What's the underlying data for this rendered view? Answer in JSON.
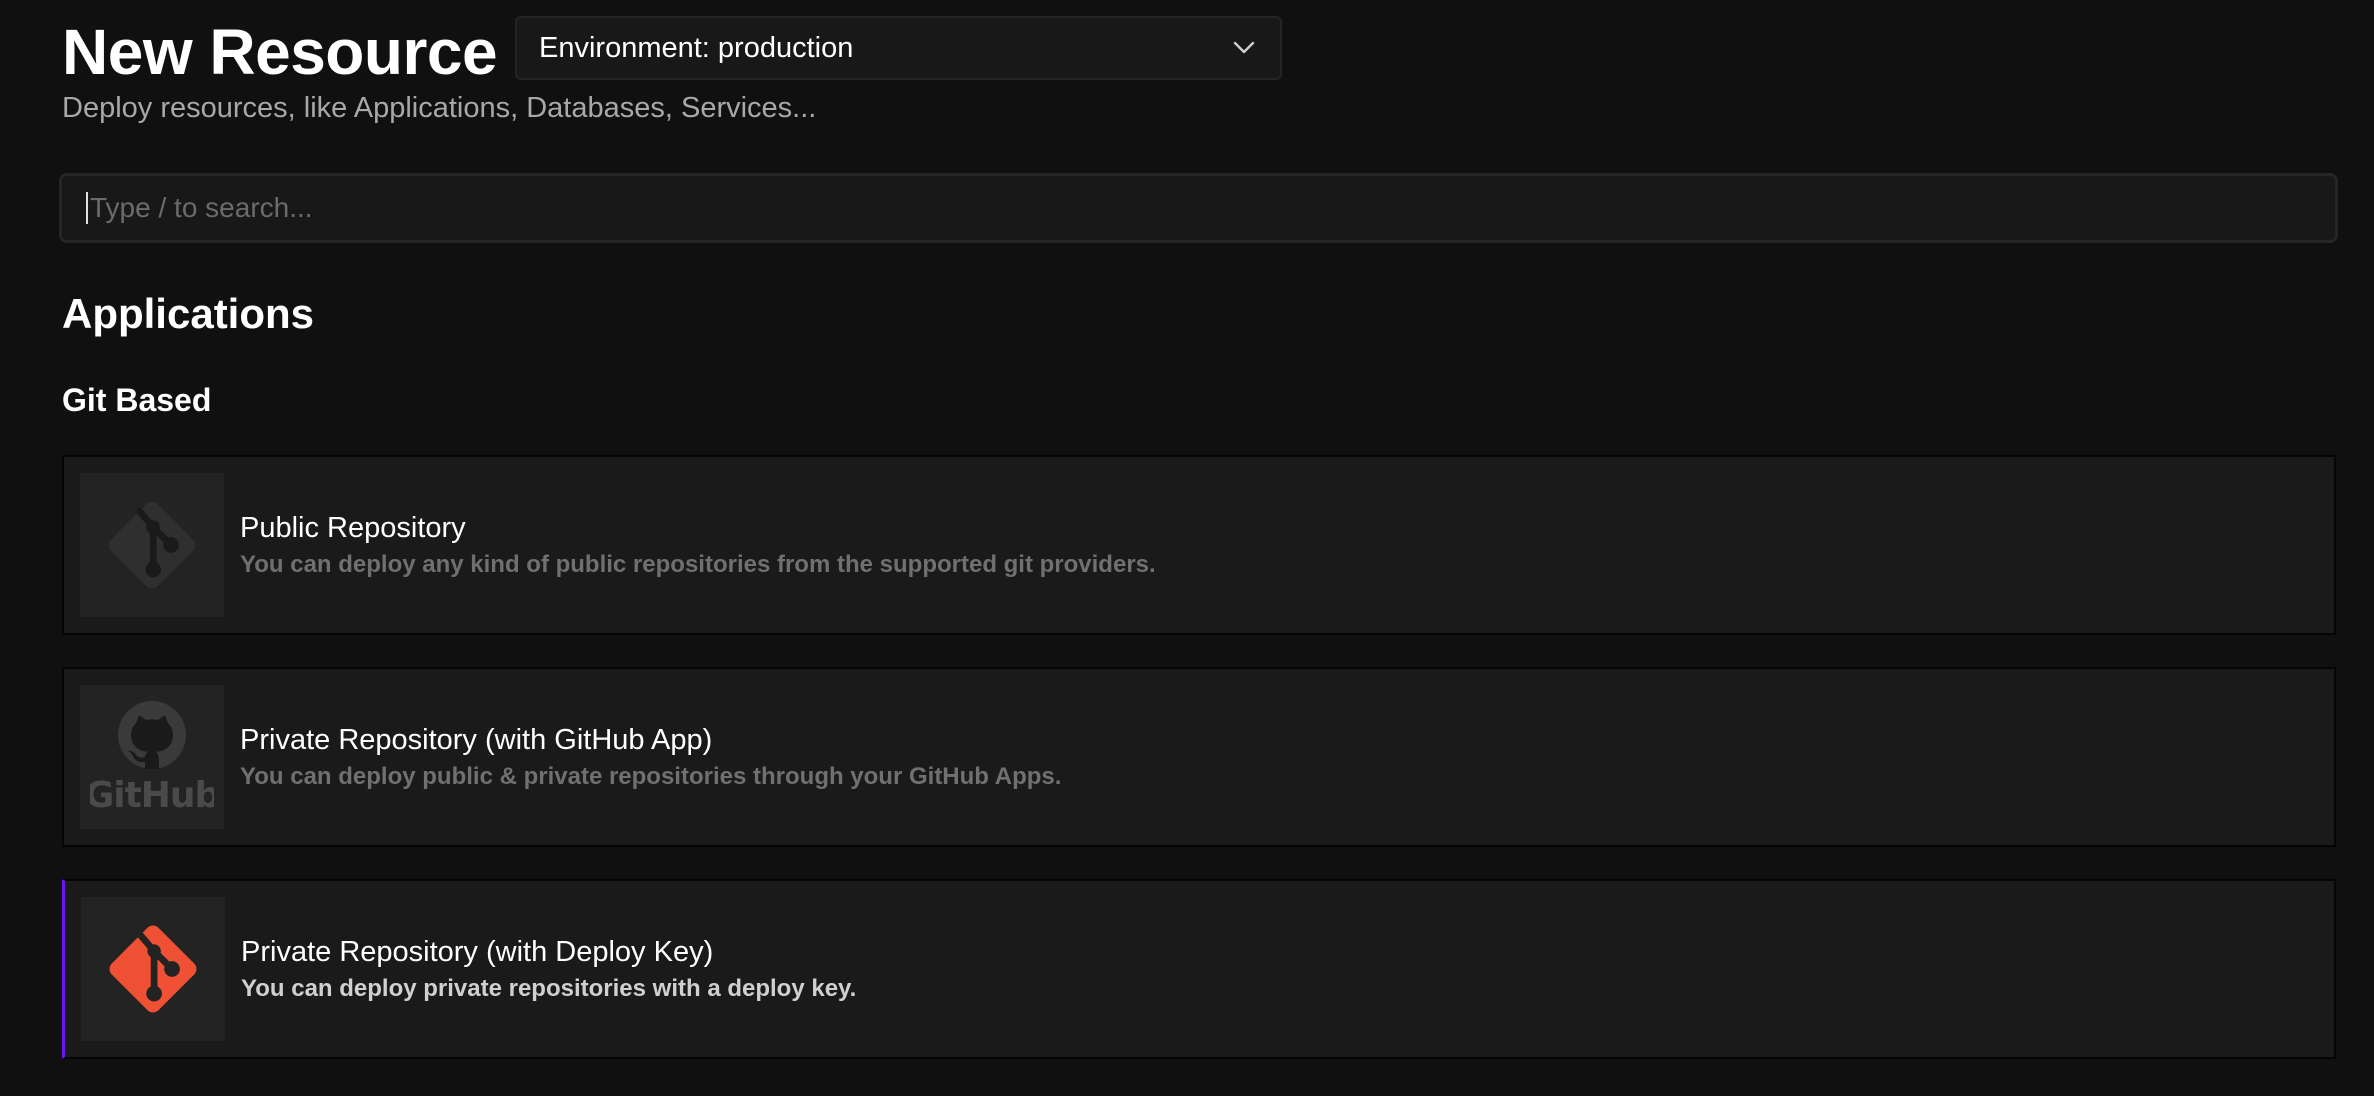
{
  "header": {
    "title": "New Resource",
    "subtitle": "Deploy resources, like Applications, Databases, Services..."
  },
  "environment_select": {
    "value": "Environment: production",
    "icon": "chevron-down-icon"
  },
  "search": {
    "placeholder": "Type / to search...",
    "value": ""
  },
  "sections": {
    "applications": {
      "title": "Applications",
      "git_based": {
        "title": "Git Based",
        "items": [
          {
            "name": "Public Repository",
            "description": "You can deploy any kind of public repositories from the supported git providers.",
            "icon": "git-icon",
            "state": "disabled"
          },
          {
            "name": "Private Repository (with GitHub App)",
            "description": "You can deploy public & private repositories through your GitHub Apps.",
            "icon": "github-icon",
            "logo_text": "GitHub",
            "state": "disabled"
          },
          {
            "name": "Private Repository (with Deploy Key)",
            "description": "You can deploy private repositories with a deploy key.",
            "icon": "git-icon",
            "state": "active"
          }
        ]
      }
    }
  },
  "colors": {
    "background": "#101010",
    "card": "#1a1a1a",
    "git_brand": "#f05033",
    "accent": "#6b16ed",
    "muted_icon": "#2f2f2f"
  }
}
